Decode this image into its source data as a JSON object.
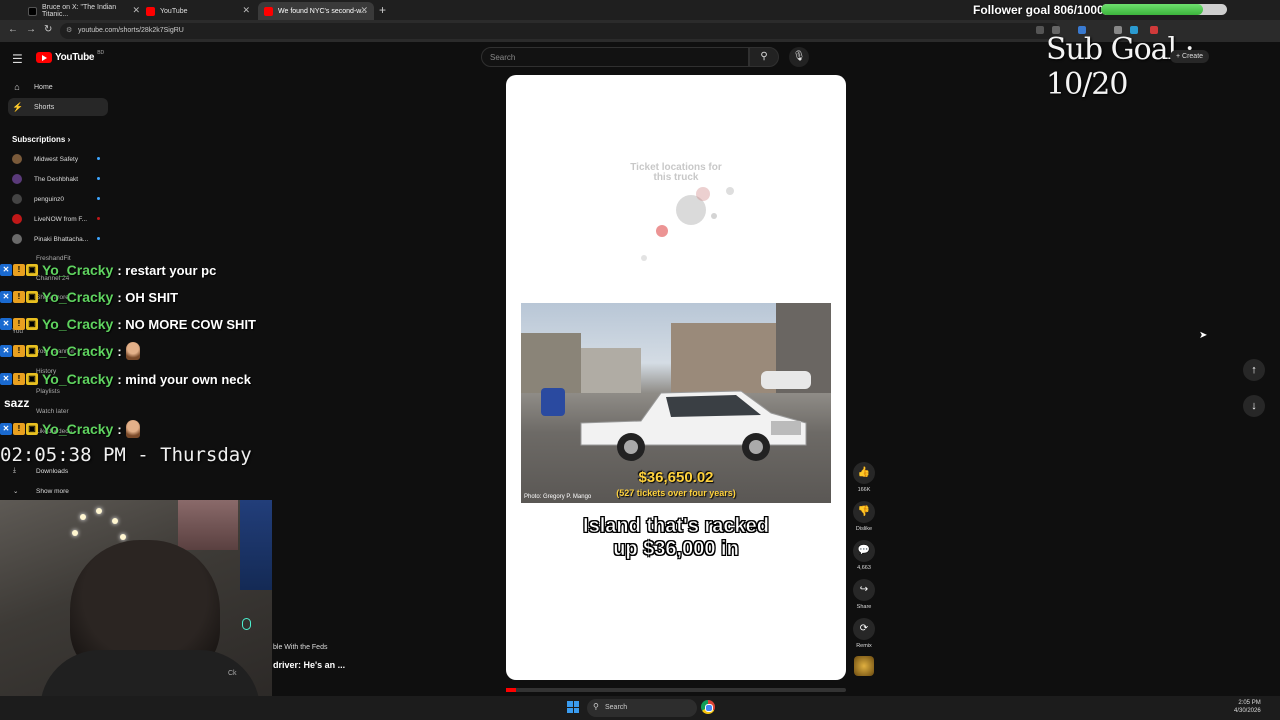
{
  "browser": {
    "tabs": [
      {
        "label": "Bruce on X: \"The Indian Titanic...",
        "icon": "x-icon",
        "color": "#000000"
      },
      {
        "label": "YouTube",
        "icon": "youtube-icon",
        "color": "#ff0000"
      },
      {
        "label": "We found NYC's second-w...",
        "icon": "youtube-icon",
        "color": "#ff0000"
      }
    ],
    "url": "youtube.com/shorts/28k2k7SigRU"
  },
  "overlay": {
    "follower_goal": "Follower goal 806/1000",
    "follower_progress": 0.806,
    "sub_goal": "Sub Goal : 10/20"
  },
  "header": {
    "logo_text": "YouTube",
    "logo_country": "BD",
    "search_placeholder": "Search",
    "create_label": "+ Create"
  },
  "sidebar": {
    "home": "Home",
    "shorts": "Shorts",
    "subscriptions": "Subscriptions",
    "subs": [
      {
        "name": "Midwest Safety",
        "color": "#7a5a3a"
      },
      {
        "name": "The Deshbhakt",
        "color": "#5a3a7a"
      },
      {
        "name": "penguinz0",
        "color": "#444444"
      },
      {
        "name": "LiveNOW from F...",
        "color": "#c01818"
      },
      {
        "name": "Pinaki Bhattacha...",
        "color": "#6a6a6a"
      }
    ],
    "faded_items": [
      "FreshandFit",
      "Channel 24",
      "Show more",
      "You",
      "Your channel",
      "History",
      "Playlists",
      "Watch later",
      "Liked videos",
      "Downloads"
    ],
    "show_more": "Show more"
  },
  "chat": {
    "messages": [
      {
        "user": "Yo_Cracky",
        "text": ": restart your pc"
      },
      {
        "user": "Yo_Cracky",
        "text": ": OH SHIT"
      },
      {
        "user": "Yo_Cracky",
        "text": ": NO MORE COW SHIT"
      },
      {
        "user": "Yo_Cracky",
        "text": ":"
      },
      {
        "user": "Yo_Cracky",
        "text": ": mind your own neck"
      },
      {
        "user": "Yo_Cracky",
        "text": ":"
      }
    ],
    "other_user": "sazz",
    "clock": "02:05:38 PM - Thursday"
  },
  "stream": {
    "kick_count": "4",
    "behind_line1": "ble With the Feds",
    "behind_line2": "driver: He's an ...",
    "cam_text": "Ck"
  },
  "short": {
    "ticket_title_line1": "Ticket locations for",
    "ticket_title_line2": "this truck",
    "price": "$36,650.02",
    "tickets": "(527 tickets over four years)",
    "credit": "Photo: Gregory P. Mango",
    "caption_line1": "Island that's racked",
    "caption_line2": "up $36,000 in",
    "progress": 0.03,
    "actions": [
      {
        "icon": "like-icon",
        "label": "166K"
      },
      {
        "icon": "dislike-icon",
        "label": "Dislike"
      },
      {
        "icon": "comment-icon",
        "label": "4,663"
      },
      {
        "icon": "share-icon",
        "label": "Share"
      },
      {
        "icon": "remix-icon",
        "label": "Remix"
      }
    ]
  },
  "taskbar": {
    "search": "Search",
    "time": "2:05 PM",
    "date": "4/30/2026"
  }
}
